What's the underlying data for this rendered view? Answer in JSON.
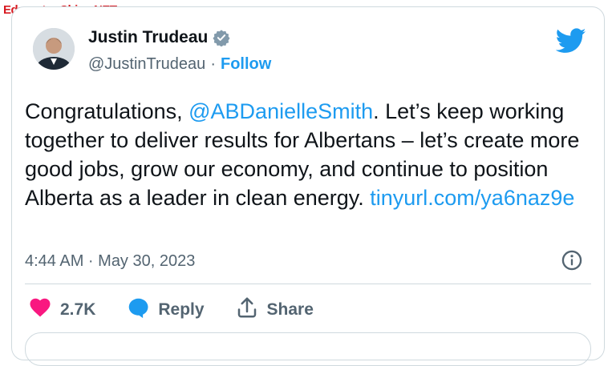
{
  "watermark": "EdmontonChina.NET",
  "author": {
    "name": "Justin Trudeau",
    "handle": "@JustinTrudeau",
    "separator": "·",
    "follow_label": "Follow"
  },
  "tweet": {
    "text_before_mention": "Congratulations, ",
    "mention": "@ABDanielleSmith",
    "text_after_mention": ". Let’s keep working together to deliver results for Albertans – let’s create more good jobs, grow our economy, and continue to position Alberta as a leader in clean energy. ",
    "link": "tinyurl.com/ya6naz9e"
  },
  "timestamp": "4:44 AM · May 30, 2023",
  "actions": {
    "like_count": "2.7K",
    "reply_label": "Reply",
    "share_label": "Share"
  },
  "colors": {
    "like": "#f91880",
    "link": "#1d9bf0",
    "verified": "#829aab"
  },
  "icons": [
    "twitter-bird-icon",
    "verified-badge-icon",
    "info-icon",
    "heart-icon",
    "reply-bubble-icon",
    "share-icon"
  ]
}
